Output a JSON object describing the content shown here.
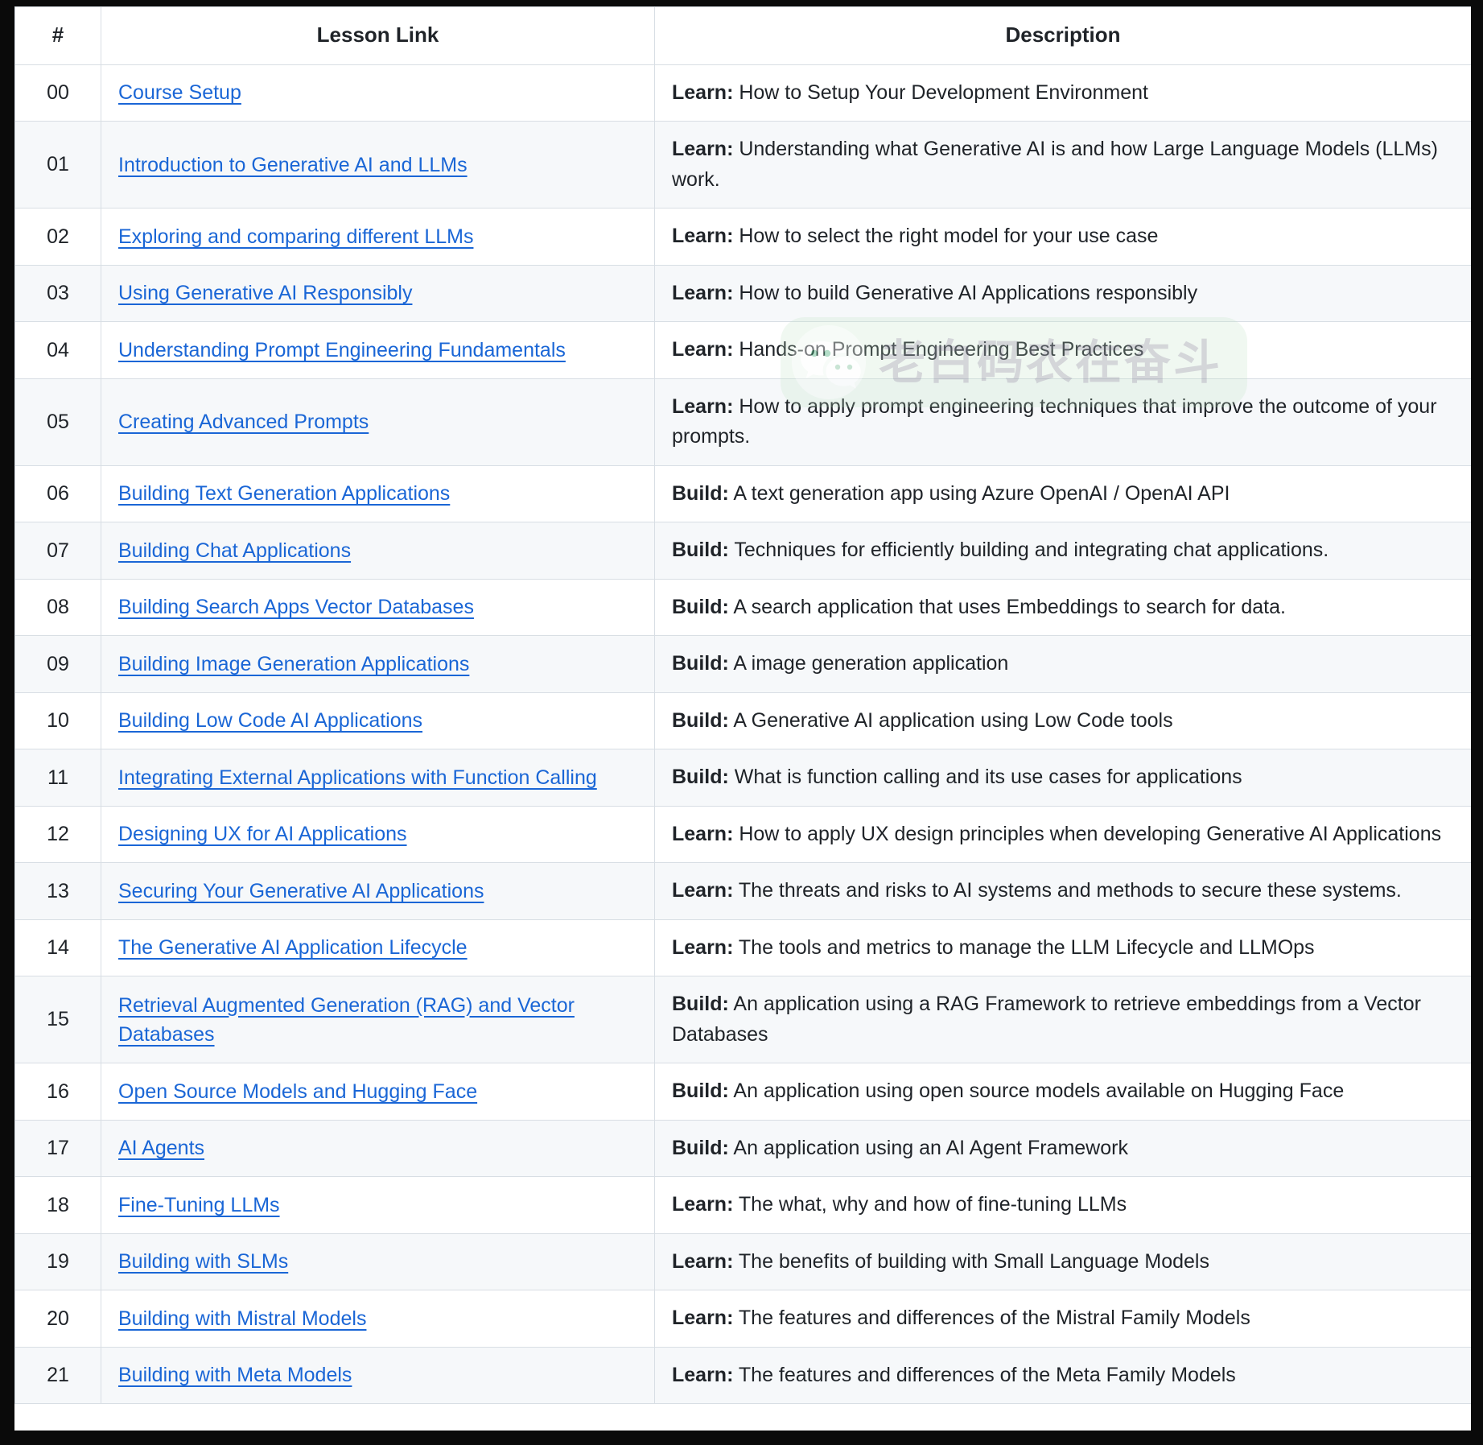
{
  "table": {
    "headers": {
      "num": "#",
      "link": "Lesson Link",
      "description": "Description"
    },
    "rows": [
      {
        "num": "00",
        "link": "Course Setup",
        "kind": "Learn:",
        "desc": " How to Setup Your Development Environment"
      },
      {
        "num": "01",
        "link": "Introduction to Generative AI and LLMs",
        "kind": "Learn:",
        "desc": " Understanding what Generative AI is and how Large Language Models (LLMs) work."
      },
      {
        "num": "02",
        "link": "Exploring and comparing different LLMs",
        "kind": "Learn:",
        "desc": " How to select the right model for your use case"
      },
      {
        "num": "03",
        "link": "Using Generative AI Responsibly",
        "kind": "Learn:",
        "desc": " How to build Generative AI Applications responsibly"
      },
      {
        "num": "04",
        "link": "Understanding Prompt Engineering Fundamentals",
        "kind": "Learn:",
        "desc": " Hands-on Prompt Engineering Best Practices"
      },
      {
        "num": "05",
        "link": "Creating Advanced Prompts",
        "kind": "Learn:",
        "desc": " How to apply prompt engineering techniques that improve the outcome of your prompts."
      },
      {
        "num": "06",
        "link": "Building Text Generation Applications",
        "kind": "Build:",
        "desc": " A text generation app using Azure OpenAI / OpenAI API"
      },
      {
        "num": "07",
        "link": "Building Chat Applications",
        "kind": "Build:",
        "desc": " Techniques for efficiently building and integrating chat applications."
      },
      {
        "num": "08",
        "link": "Building Search Apps Vector Databases",
        "kind": "Build:",
        "desc": " A search application that uses Embeddings to search for data."
      },
      {
        "num": "09",
        "link": "Building Image Generation Applications",
        "kind": "Build:",
        "desc": " A image generation application"
      },
      {
        "num": "10",
        "link": "Building Low Code AI Applications",
        "kind": "Build:",
        "desc": " A Generative AI application using Low Code tools"
      },
      {
        "num": "11",
        "link": "Integrating External Applications with Function Calling",
        "kind": "Build:",
        "desc": " What is function calling and its use cases for applications"
      },
      {
        "num": "12",
        "link": "Designing UX for AI Applications",
        "kind": "Learn:",
        "desc": " How to apply UX design principles when developing Generative AI Applications"
      },
      {
        "num": "13",
        "link": "Securing Your Generative AI Applications",
        "kind": "Learn:",
        "desc": " The threats and risks to AI systems and methods to secure these systems."
      },
      {
        "num": "14",
        "link": "The Generative AI Application Lifecycle",
        "kind": "Learn:",
        "desc": " The tools and metrics to manage the LLM Lifecycle and LLMOps"
      },
      {
        "num": "15",
        "link": "Retrieval Augmented Generation (RAG) and Vector Databases",
        "kind": "Build:",
        "desc": " An application using a RAG Framework to retrieve embeddings from a Vector Databases"
      },
      {
        "num": "16",
        "link": "Open Source Models and Hugging Face",
        "kind": "Build:",
        "desc": " An application using open source models available on Hugging Face"
      },
      {
        "num": "17",
        "link": "AI Agents",
        "kind": "Build:",
        "desc": " An application using an AI Agent Framework"
      },
      {
        "num": "18",
        "link": "Fine-Tuning LLMs",
        "kind": "Learn:",
        "desc": " The what, why and how of fine-tuning LLMs"
      },
      {
        "num": "19",
        "link": "Building with SLMs",
        "kind": "Learn:",
        "desc": " The benefits of building with Small Language Models"
      },
      {
        "num": "20",
        "link": "Building with Mistral Models",
        "kind": "Learn:",
        "desc": " The features and differences of the Mistral Family Models"
      },
      {
        "num": "21",
        "link": "Building with Meta Models",
        "kind": "Learn:",
        "desc": " The features and differences of the Meta Family Models"
      }
    ]
  },
  "watermark": {
    "text": "老白码农在奋斗",
    "icon": "wechat-logo-icon",
    "badge_color": "#bfe3c4",
    "text_color": "#9aa0a6"
  },
  "colors": {
    "link": "#1a66d6",
    "text": "#1f2328",
    "border": "#d8dee4",
    "row_alt_bg": "#f6f8fa",
    "row_bg": "#ffffff",
    "frame": "#0a0a0a"
  }
}
